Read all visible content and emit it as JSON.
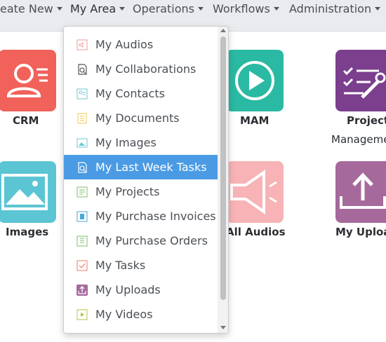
{
  "nav": {
    "items": [
      {
        "label": "eate New"
      },
      {
        "label": "My Area"
      },
      {
        "label": "Operations"
      },
      {
        "label": "Workflows"
      },
      {
        "label": "Administration"
      }
    ]
  },
  "tiles": [
    {
      "label": "CRM",
      "color": "#f0625a",
      "icon": "user-card-icon"
    },
    {
      "label": "MAM",
      "color": "#2ab9a2",
      "icon": "play-icon"
    },
    {
      "label": "Project",
      "label2": "Manageme",
      "color": "#7b3f8e",
      "icon": "tasks-wrench-icon"
    },
    {
      "label": "Images",
      "color": "#5bc5d3",
      "icon": "image-icon"
    },
    {
      "label": "All Audios",
      "color": "#f7b3b6",
      "icon": "speaker-icon"
    },
    {
      "label": "My Uploa",
      "color": "#a56a9b",
      "icon": "upload-icon"
    }
  ],
  "dropdown": {
    "items": [
      {
        "label": "My Audios",
        "icon": "audio-icon",
        "color": "#f19a9a"
      },
      {
        "label": "My Collaborations",
        "icon": "collaboration-icon",
        "color": "#555555"
      },
      {
        "label": "My Contacts",
        "icon": "contacts-icon",
        "color": "#6cc7d5"
      },
      {
        "label": "My Documents",
        "icon": "document-icon",
        "color": "#f2c94c"
      },
      {
        "label": "My Images",
        "icon": "image-icon",
        "color": "#6cc7d5"
      },
      {
        "label": "My Last Week Tasks",
        "icon": "task-search-icon",
        "color": "#ffffff",
        "active": true
      },
      {
        "label": "My Projects",
        "icon": "projects-icon",
        "color": "#7fbf6a"
      },
      {
        "label": "My Purchase Invoices",
        "icon": "invoice-icon",
        "color": "#4aa8d8"
      },
      {
        "label": "My Purchase Orders",
        "icon": "order-icon",
        "color": "#7fbf6a"
      },
      {
        "label": "My Tasks",
        "icon": "tasks-icon",
        "color": "#f07a6a"
      },
      {
        "label": "My Uploads",
        "icon": "upload-icon",
        "color": "#a56a9b"
      },
      {
        "label": "My Videos",
        "icon": "video-icon",
        "color": "#a8c83e"
      }
    ]
  }
}
